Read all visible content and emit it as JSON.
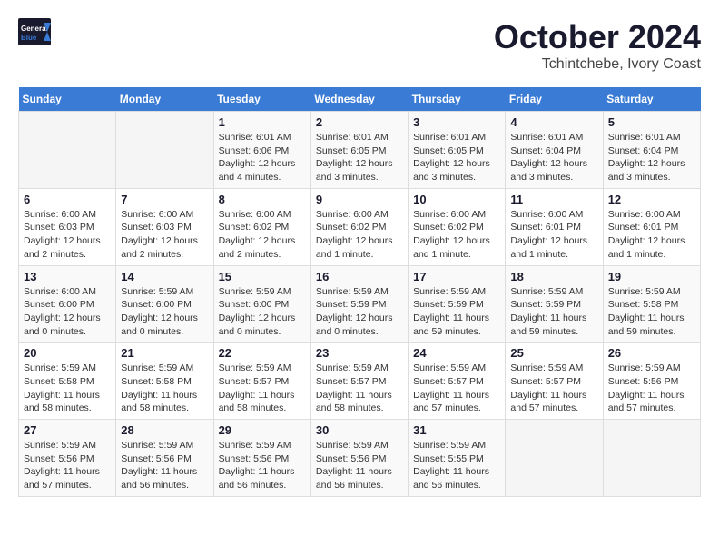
{
  "header": {
    "logo_general": "General",
    "logo_blue": "Blue",
    "month_title": "October 2024",
    "location": "Tchintchebe, Ivory Coast"
  },
  "weekdays": [
    "Sunday",
    "Monday",
    "Tuesday",
    "Wednesday",
    "Thursday",
    "Friday",
    "Saturday"
  ],
  "weeks": [
    [
      {
        "day": "",
        "info": ""
      },
      {
        "day": "",
        "info": ""
      },
      {
        "day": "1",
        "info": "Sunrise: 6:01 AM\nSunset: 6:06 PM\nDaylight: 12 hours and 4 minutes."
      },
      {
        "day": "2",
        "info": "Sunrise: 6:01 AM\nSunset: 6:05 PM\nDaylight: 12 hours and 3 minutes."
      },
      {
        "day": "3",
        "info": "Sunrise: 6:01 AM\nSunset: 6:05 PM\nDaylight: 12 hours and 3 minutes."
      },
      {
        "day": "4",
        "info": "Sunrise: 6:01 AM\nSunset: 6:04 PM\nDaylight: 12 hours and 3 minutes."
      },
      {
        "day": "5",
        "info": "Sunrise: 6:01 AM\nSunset: 6:04 PM\nDaylight: 12 hours and 3 minutes."
      }
    ],
    [
      {
        "day": "6",
        "info": "Sunrise: 6:00 AM\nSunset: 6:03 PM\nDaylight: 12 hours and 2 minutes."
      },
      {
        "day": "7",
        "info": "Sunrise: 6:00 AM\nSunset: 6:03 PM\nDaylight: 12 hours and 2 minutes."
      },
      {
        "day": "8",
        "info": "Sunrise: 6:00 AM\nSunset: 6:02 PM\nDaylight: 12 hours and 2 minutes."
      },
      {
        "day": "9",
        "info": "Sunrise: 6:00 AM\nSunset: 6:02 PM\nDaylight: 12 hours and 1 minute."
      },
      {
        "day": "10",
        "info": "Sunrise: 6:00 AM\nSunset: 6:02 PM\nDaylight: 12 hours and 1 minute."
      },
      {
        "day": "11",
        "info": "Sunrise: 6:00 AM\nSunset: 6:01 PM\nDaylight: 12 hours and 1 minute."
      },
      {
        "day": "12",
        "info": "Sunrise: 6:00 AM\nSunset: 6:01 PM\nDaylight: 12 hours and 1 minute."
      }
    ],
    [
      {
        "day": "13",
        "info": "Sunrise: 6:00 AM\nSunset: 6:00 PM\nDaylight: 12 hours and 0 minutes."
      },
      {
        "day": "14",
        "info": "Sunrise: 5:59 AM\nSunset: 6:00 PM\nDaylight: 12 hours and 0 minutes."
      },
      {
        "day": "15",
        "info": "Sunrise: 5:59 AM\nSunset: 6:00 PM\nDaylight: 12 hours and 0 minutes."
      },
      {
        "day": "16",
        "info": "Sunrise: 5:59 AM\nSunset: 5:59 PM\nDaylight: 12 hours and 0 minutes."
      },
      {
        "day": "17",
        "info": "Sunrise: 5:59 AM\nSunset: 5:59 PM\nDaylight: 11 hours and 59 minutes."
      },
      {
        "day": "18",
        "info": "Sunrise: 5:59 AM\nSunset: 5:59 PM\nDaylight: 11 hours and 59 minutes."
      },
      {
        "day": "19",
        "info": "Sunrise: 5:59 AM\nSunset: 5:58 PM\nDaylight: 11 hours and 59 minutes."
      }
    ],
    [
      {
        "day": "20",
        "info": "Sunrise: 5:59 AM\nSunset: 5:58 PM\nDaylight: 11 hours and 58 minutes."
      },
      {
        "day": "21",
        "info": "Sunrise: 5:59 AM\nSunset: 5:58 PM\nDaylight: 11 hours and 58 minutes."
      },
      {
        "day": "22",
        "info": "Sunrise: 5:59 AM\nSunset: 5:57 PM\nDaylight: 11 hours and 58 minutes."
      },
      {
        "day": "23",
        "info": "Sunrise: 5:59 AM\nSunset: 5:57 PM\nDaylight: 11 hours and 58 minutes."
      },
      {
        "day": "24",
        "info": "Sunrise: 5:59 AM\nSunset: 5:57 PM\nDaylight: 11 hours and 57 minutes."
      },
      {
        "day": "25",
        "info": "Sunrise: 5:59 AM\nSunset: 5:57 PM\nDaylight: 11 hours and 57 minutes."
      },
      {
        "day": "26",
        "info": "Sunrise: 5:59 AM\nSunset: 5:56 PM\nDaylight: 11 hours and 57 minutes."
      }
    ],
    [
      {
        "day": "27",
        "info": "Sunrise: 5:59 AM\nSunset: 5:56 PM\nDaylight: 11 hours and 57 minutes."
      },
      {
        "day": "28",
        "info": "Sunrise: 5:59 AM\nSunset: 5:56 PM\nDaylight: 11 hours and 56 minutes."
      },
      {
        "day": "29",
        "info": "Sunrise: 5:59 AM\nSunset: 5:56 PM\nDaylight: 11 hours and 56 minutes."
      },
      {
        "day": "30",
        "info": "Sunrise: 5:59 AM\nSunset: 5:56 PM\nDaylight: 11 hours and 56 minutes."
      },
      {
        "day": "31",
        "info": "Sunrise: 5:59 AM\nSunset: 5:55 PM\nDaylight: 11 hours and 56 minutes."
      },
      {
        "day": "",
        "info": ""
      },
      {
        "day": "",
        "info": ""
      }
    ]
  ]
}
